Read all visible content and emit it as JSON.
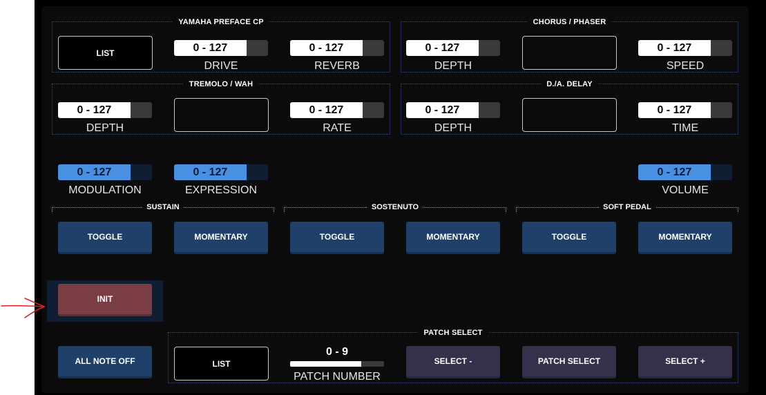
{
  "groups": {
    "yamaha": {
      "title": "YAMAHA PREFACE CP",
      "list_label": "LIST",
      "drive": {
        "value": "0 - 127",
        "label": "DRIVE",
        "fill": 0.77
      },
      "reverb": {
        "value": "0 - 127",
        "label": "REVERB",
        "fill": 0.77
      }
    },
    "chorus": {
      "title": "CHORUS / PHASER",
      "depth": {
        "value": "0 - 127",
        "label": "DEPTH",
        "fill": 0.77
      },
      "speed": {
        "value": "0 - 127",
        "label": "SPEED",
        "fill": 0.77
      }
    },
    "tremolo": {
      "title": "TREMOLO / WAH",
      "depth": {
        "value": "0 - 127",
        "label": "DEPTH",
        "fill": 0.77
      },
      "rate": {
        "value": "0 - 127",
        "label": "RATE",
        "fill": 0.77
      }
    },
    "delay": {
      "title": "D./A. DELAY",
      "depth": {
        "value": "0 - 127",
        "label": "DEPTH",
        "fill": 0.77
      },
      "time": {
        "value": "0 - 127",
        "label": "TIME",
        "fill": 0.77
      }
    }
  },
  "controllers": {
    "modulation": {
      "value": "0 - 127",
      "label": "MODULATION",
      "fill": 0.77
    },
    "expression": {
      "value": "0 - 127",
      "label": "EXPRESSION",
      "fill": 0.77
    },
    "volume": {
      "value": "0 - 127",
      "label": "VOLUME",
      "fill": 0.77
    }
  },
  "pedals": {
    "sustain": {
      "title": "SUSTAIN",
      "toggle": "TOGGLE",
      "momentary": "MOMENTARY"
    },
    "sostenuto": {
      "title": "SOSTENUTO",
      "toggle": "TOGGLE",
      "momentary": "MOMENTARY"
    },
    "soft": {
      "title": "SOFT PEDAL",
      "toggle": "TOGGLE",
      "momentary": "MOMENTARY"
    }
  },
  "init_label": "INIT",
  "all_note_off_label": "ALL NOTE OFF",
  "patch": {
    "title": "PATCH SELECT",
    "list_label": "LIST",
    "number_value": "0 - 9",
    "number_label": "PATCH NUMBER",
    "number_fill": 0.76,
    "select_minus": "SELECT -",
    "patch_select": "PATCH SELECT",
    "select_plus": "SELECT +"
  },
  "colors": {
    "accent_blue": "#4a90e2",
    "button_blue": "#1f4068",
    "init_red": "#7a3d44",
    "annotation_red": "#e02020"
  }
}
